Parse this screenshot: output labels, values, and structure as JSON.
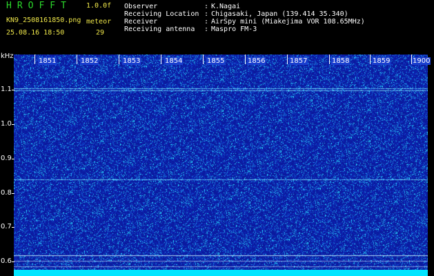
{
  "header": {
    "logo_text": "HROFFT",
    "version": "1.0.0f",
    "filename": "KN9_2508161850.png",
    "meteor_label": "meteor",
    "datetime": "25.08.16 18:50",
    "meteor_count": "29",
    "info": [
      {
        "key": "Observer",
        "sep": ":",
        "value": "K.Nagai"
      },
      {
        "key": "Receiving Location",
        "sep": ":",
        "value": "Chigasaki, Japan (139.414 35.340)"
      },
      {
        "key": "Receiver",
        "sep": ":",
        "value": "AirSpy mini (Miakejima VOR 108.65MHz)"
      },
      {
        "key": "Receiving antenna",
        "sep": ":",
        "value": "Maspro FM-3"
      }
    ]
  },
  "axis": {
    "unit": "kHz",
    "y_labels": [
      "1.1",
      "1.0",
      "0.9",
      "0.8",
      "0.7",
      "0.6"
    ],
    "time_labels": [
      "1851",
      "1852",
      "1853",
      "1854",
      "1855",
      "1856",
      "1857",
      "1858",
      "1859",
      "1900"
    ]
  },
  "colors": {
    "logo": "#2bd92b",
    "background": "#0b1a9e",
    "noise_bright": "#2fd0ff",
    "bottom_bar": "#00e5ff"
  },
  "spectrogram": {
    "freq_min_khz": 0.58,
    "freq_max_khz": 1.19,
    "signal_lines_khz": [
      1.095,
      1.088,
      0.836,
      0.622
    ]
  }
}
